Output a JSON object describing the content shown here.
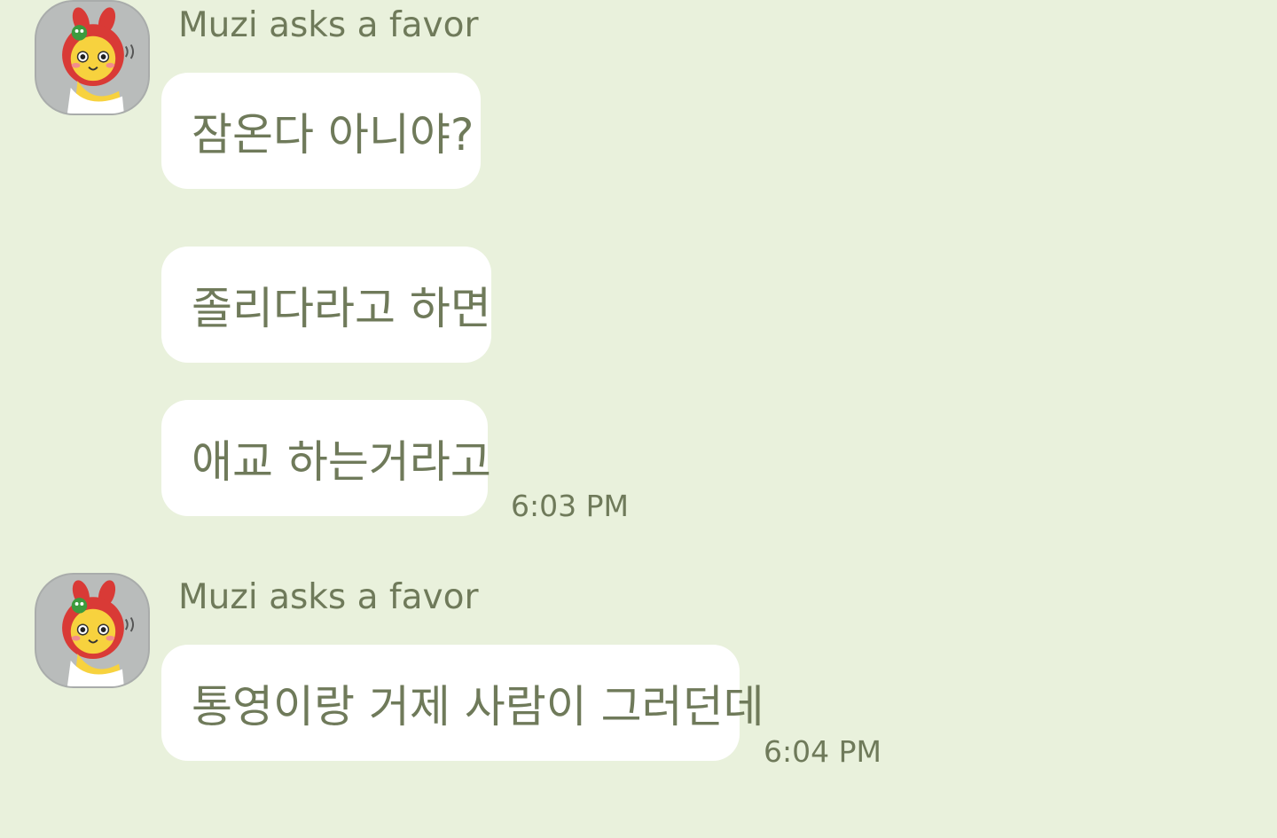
{
  "groups": [
    {
      "avatar": "muzi-avatar",
      "sender": "Muzi asks a favor",
      "messages": [
        "잠온다 아니야?",
        "졸리다라고 하면",
        "애교 하는거라고"
      ],
      "time": "6:03 PM"
    },
    {
      "avatar": "muzi-avatar",
      "sender": "Muzi asks a favor",
      "messages": [
        "통영이랑 거제 사람이 그러던데"
      ],
      "time": "6:04 PM"
    }
  ],
  "colors": {
    "background": "#e9f1dc",
    "bubble": "#ffffff",
    "text": "#6f7a5a"
  }
}
